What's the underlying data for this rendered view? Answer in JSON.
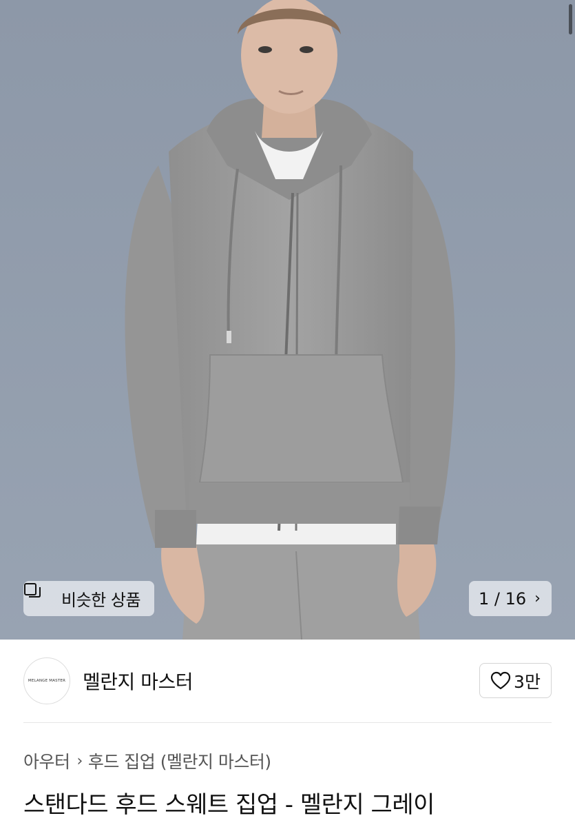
{
  "hero": {
    "image_alt": "product photo of model in gray zip-up hoodie",
    "similar_button": {
      "label": "비슷한 상품",
      "icon": "similar-products-icon"
    },
    "pager": {
      "label": "1 / 16",
      "icon": "chevron-right-icon"
    }
  },
  "brand": {
    "logo_text": "MELANGE MASTER",
    "name": "멜란지 마스터",
    "like": {
      "count": "3만",
      "icon": "heart-outline-icon"
    }
  },
  "breadcrumb": {
    "items": [
      "아우터",
      "후드 집업 (멜란지 마스터)"
    ],
    "separator_icon": "chevron-right-icon"
  },
  "product": {
    "title": "스탠다드 후드 스웨트 집업 - 멜란지 그레이"
  },
  "colors": {
    "background": "#8e9aab",
    "hoodie": "#9b9b9b",
    "button_bg": "#e0e4e9"
  }
}
